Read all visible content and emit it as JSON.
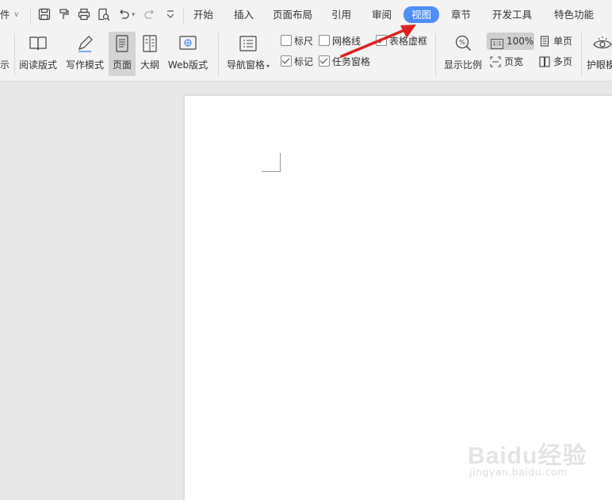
{
  "menubar": {
    "file_partial": "件",
    "tabs": [
      "开始",
      "插入",
      "页面布局",
      "引用",
      "审阅",
      "视图",
      "章节",
      "开发工具",
      "特色功能"
    ],
    "active_tab": "视图"
  },
  "ribbon": {
    "left_partial_label": "示",
    "buttons": {
      "reading_mode": "阅读版式",
      "writing_mode": "写作模式",
      "page": "页面",
      "outline": "大纲",
      "web_layout": "Web版式",
      "nav_pane": "导航窗格",
      "zoom": "显示比例",
      "eye_protection": "护眼模"
    },
    "checkboxes": {
      "ruler": {
        "label": "标尺",
        "checked": false
      },
      "gridlines": {
        "label": "网格线",
        "checked": false
      },
      "table_gridlines": {
        "label": "表格虚框",
        "checked": true
      },
      "marks": {
        "label": "标记",
        "checked": true
      },
      "task_pane": {
        "label": "任务窗格",
        "checked": true
      }
    },
    "zoom_value": "100%",
    "page_width": "页宽",
    "single_page": "单页",
    "multi_page": "多页"
  },
  "annotation": {
    "arrow_color": "#e02020"
  },
  "watermark": {
    "logo": "Baidu经验",
    "url": "jingyan.baidu.com"
  },
  "colors": {
    "accent": "#4e8ef7",
    "ribbon_bg": "#f3f3f3",
    "canvas_bg": "#e8e8e8"
  }
}
